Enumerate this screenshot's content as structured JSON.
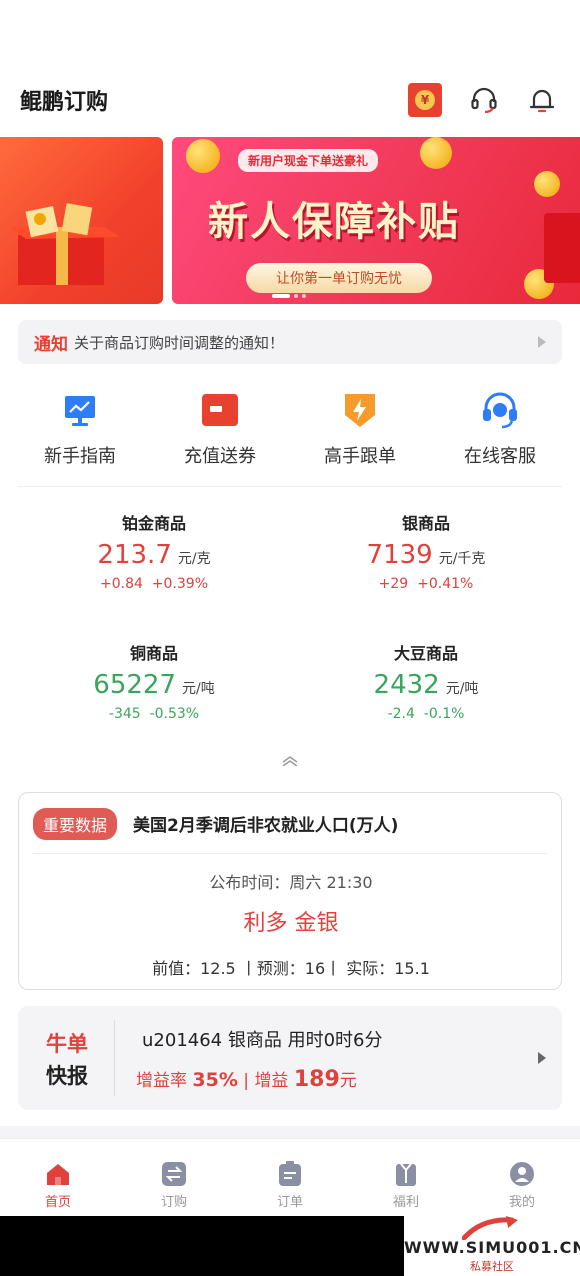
{
  "header": {
    "title": "鲲鹏订购",
    "coin_glyph": "¥"
  },
  "banner": {
    "badge": "新用户现金下单送豪礼",
    "headline": "新人保障补贴",
    "pill": "让你第一单订购无忧"
  },
  "notice": {
    "tag": "通知",
    "text": "关于商品订购时间调整的通知！"
  },
  "shortcuts": [
    {
      "label": "新手指南",
      "icon": "monitor-chart-icon"
    },
    {
      "label": "充值送券",
      "icon": "wallet-icon"
    },
    {
      "label": "高手跟单",
      "icon": "lightning-shield-icon"
    },
    {
      "label": "在线客服",
      "icon": "headset-icon"
    }
  ],
  "quotes": [
    {
      "name": "铂金商品",
      "price": "213.7",
      "unit": "元/克",
      "change": "+0.84",
      "pct": "+0.39%",
      "trend": "up"
    },
    {
      "name": "银商品",
      "price": "7139",
      "unit": "元/千克",
      "change": "+29",
      "pct": "+0.41%",
      "trend": "up"
    },
    {
      "name": "铜商品",
      "price": "65227",
      "unit": "元/吨",
      "change": "-345",
      "pct": "-0.53%",
      "trend": "down"
    },
    {
      "name": "大豆商品",
      "price": "2432",
      "unit": "元/吨",
      "change": "-2.4",
      "pct": "-0.1%",
      "trend": "down"
    }
  ],
  "data_card": {
    "tag": "重要数据",
    "title": "美国2月季调后非农就业人口(万人)",
    "time": "公布时间：周六 21:30",
    "impact": "利多 金银",
    "values": "前值：12.5  丨预测：16丨  实际：15.1"
  },
  "bull": {
    "t1": "牛单",
    "t2": "快报",
    "line1": "u201464 银商品 用时0时6分",
    "rate_label": "增益率",
    "rate": "35%",
    "gain_label": "增益",
    "gain": "189",
    "gain_unit": "元"
  },
  "tabs": [
    {
      "label": "首页",
      "icon": "home-icon",
      "active": true
    },
    {
      "label": "订购",
      "icon": "swap-icon",
      "active": false
    },
    {
      "label": "订单",
      "icon": "clipboard-icon",
      "active": false
    },
    {
      "label": "福利",
      "icon": "gift-icon",
      "active": false
    },
    {
      "label": "我的",
      "icon": "user-icon",
      "active": false
    }
  ],
  "watermark": {
    "site": "WWW.SIMU001.CN",
    "sub": "私募社区"
  },
  "colors": {
    "accent": "#e0413c",
    "up": "#e0413c",
    "down": "#3aa55d"
  }
}
